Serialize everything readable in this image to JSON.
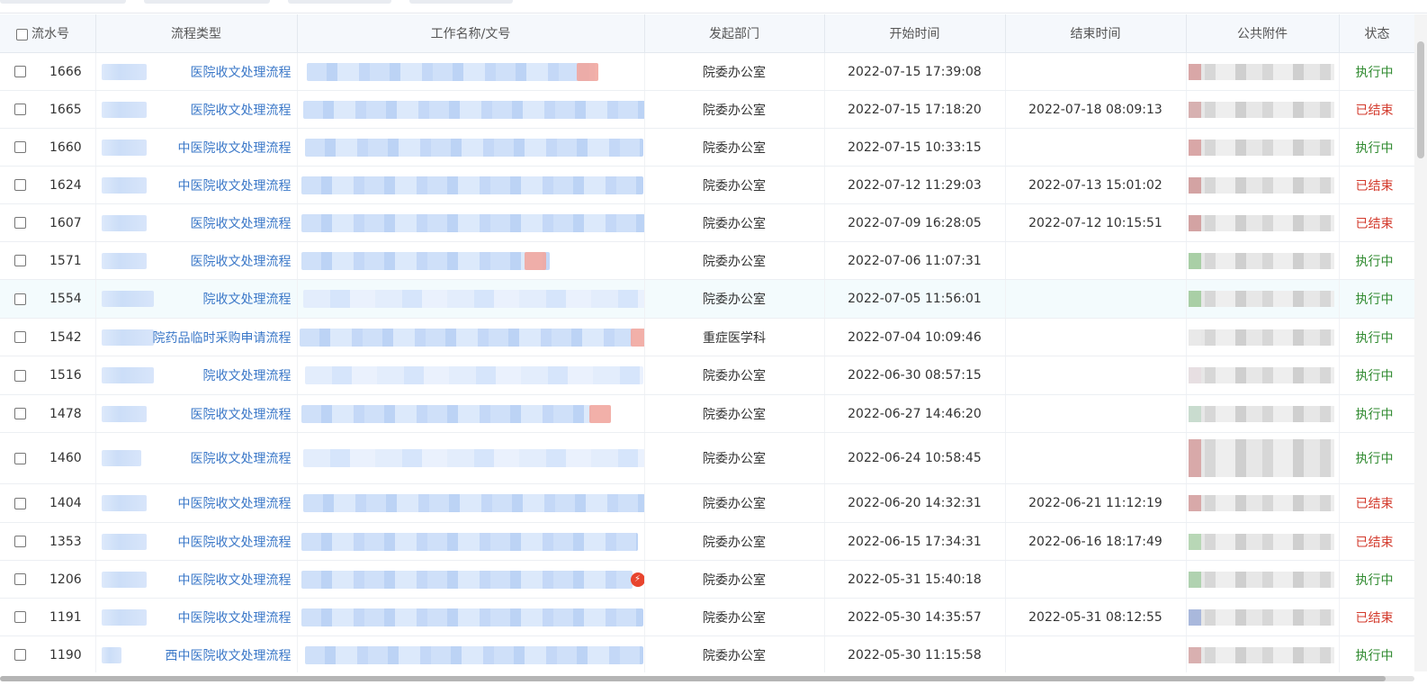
{
  "columns": {
    "serial": "流水号",
    "flow_type": "流程类型",
    "work_name": "工作名称/文号",
    "department": "发起部门",
    "start_time": "开始时间",
    "end_time": "结束时间",
    "attachments": "公共附件",
    "status": "状态"
  },
  "rows": [
    {
      "serial": "1666",
      "flow_type": "医院收文处理流程",
      "department": "院委办公室",
      "start_time": "2022-07-15 17:39:08",
      "end_time": "",
      "status": "执行中"
    },
    {
      "serial": "1665",
      "flow_type": "医院收文处理流程",
      "department": "院委办公室",
      "start_time": "2022-07-15 17:18:20",
      "end_time": "2022-07-18 08:09:13",
      "status": "已结束"
    },
    {
      "serial": "1660",
      "flow_type": "中医院收文处理流程",
      "department": "院委办公室",
      "start_time": "2022-07-15 10:33:15",
      "end_time": "",
      "status": "执行中"
    },
    {
      "serial": "1624",
      "flow_type": "中医院收文处理流程",
      "department": "院委办公室",
      "start_time": "2022-07-12 11:29:03",
      "end_time": "2022-07-13 15:01:02",
      "status": "已结束"
    },
    {
      "serial": "1607",
      "flow_type": "医院收文处理流程",
      "department": "院委办公室",
      "start_time": "2022-07-09 16:28:05",
      "end_time": "2022-07-12 10:15:51",
      "status": "已结束"
    },
    {
      "serial": "1571",
      "flow_type": "医院收文处理流程",
      "department": "院委办公室",
      "start_time": "2022-07-06 11:07:31",
      "end_time": "",
      "status": "执行中"
    },
    {
      "serial": "1554",
      "flow_type": "院收文处理流程",
      "department": "院委办公室",
      "start_time": "2022-07-05 11:56:01",
      "end_time": "",
      "status": "执行中"
    },
    {
      "serial": "1542",
      "flow_type": "院药品临时采购申请流程",
      "department": "重症医学科",
      "start_time": "2022-07-04 10:09:46",
      "end_time": "",
      "status": "执行中"
    },
    {
      "serial": "1516",
      "flow_type": "院收文处理流程",
      "department": "院委办公室",
      "start_time": "2022-06-30 08:57:15",
      "end_time": "",
      "status": "执行中"
    },
    {
      "serial": "1478",
      "flow_type": "医院收文处理流程",
      "department": "院委办公室",
      "start_time": "2022-06-27 14:46:20",
      "end_time": "",
      "status": "执行中"
    },
    {
      "serial": "1460",
      "flow_type": "医院收文处理流程",
      "department": "院委办公室",
      "start_time": "2022-06-24 10:58:45",
      "end_time": "",
      "status": "执行中"
    },
    {
      "serial": "1404",
      "flow_type": "中医院收文处理流程",
      "department": "院委办公室",
      "start_time": "2022-06-20 14:32:31",
      "end_time": "2022-06-21 11:12:19",
      "status": "已结束"
    },
    {
      "serial": "1353",
      "flow_type": "中医院收文处理流程",
      "department": "院委办公室",
      "start_time": "2022-06-15 17:34:31",
      "end_time": "2022-06-16 18:17:49",
      "status": "已结束"
    },
    {
      "serial": "1206",
      "flow_type": "中医院收文处理流程",
      "department": "院委办公室",
      "start_time": "2022-05-31 15:40:18",
      "end_time": "",
      "status": "执行中"
    },
    {
      "serial": "1191",
      "flow_type": "中医院收文处理流程",
      "department": "院委办公室",
      "start_time": "2022-05-30 14:35:57",
      "end_time": "2022-05-31 08:12:55",
      "status": "已结束"
    },
    {
      "serial": "1190",
      "flow_type": "西中医院收文处理流程",
      "department": "院委办公室",
      "start_time": "2022-05-30 11:15:58",
      "end_time": "",
      "status": "执行中"
    }
  ],
  "colors": {
    "link": "#3b78c8",
    "status_executing": "#2f8a2f",
    "status_finished": "#d33a2c",
    "header_bg": "#f5f8fc",
    "highlight_row": "#f3fbfd"
  }
}
